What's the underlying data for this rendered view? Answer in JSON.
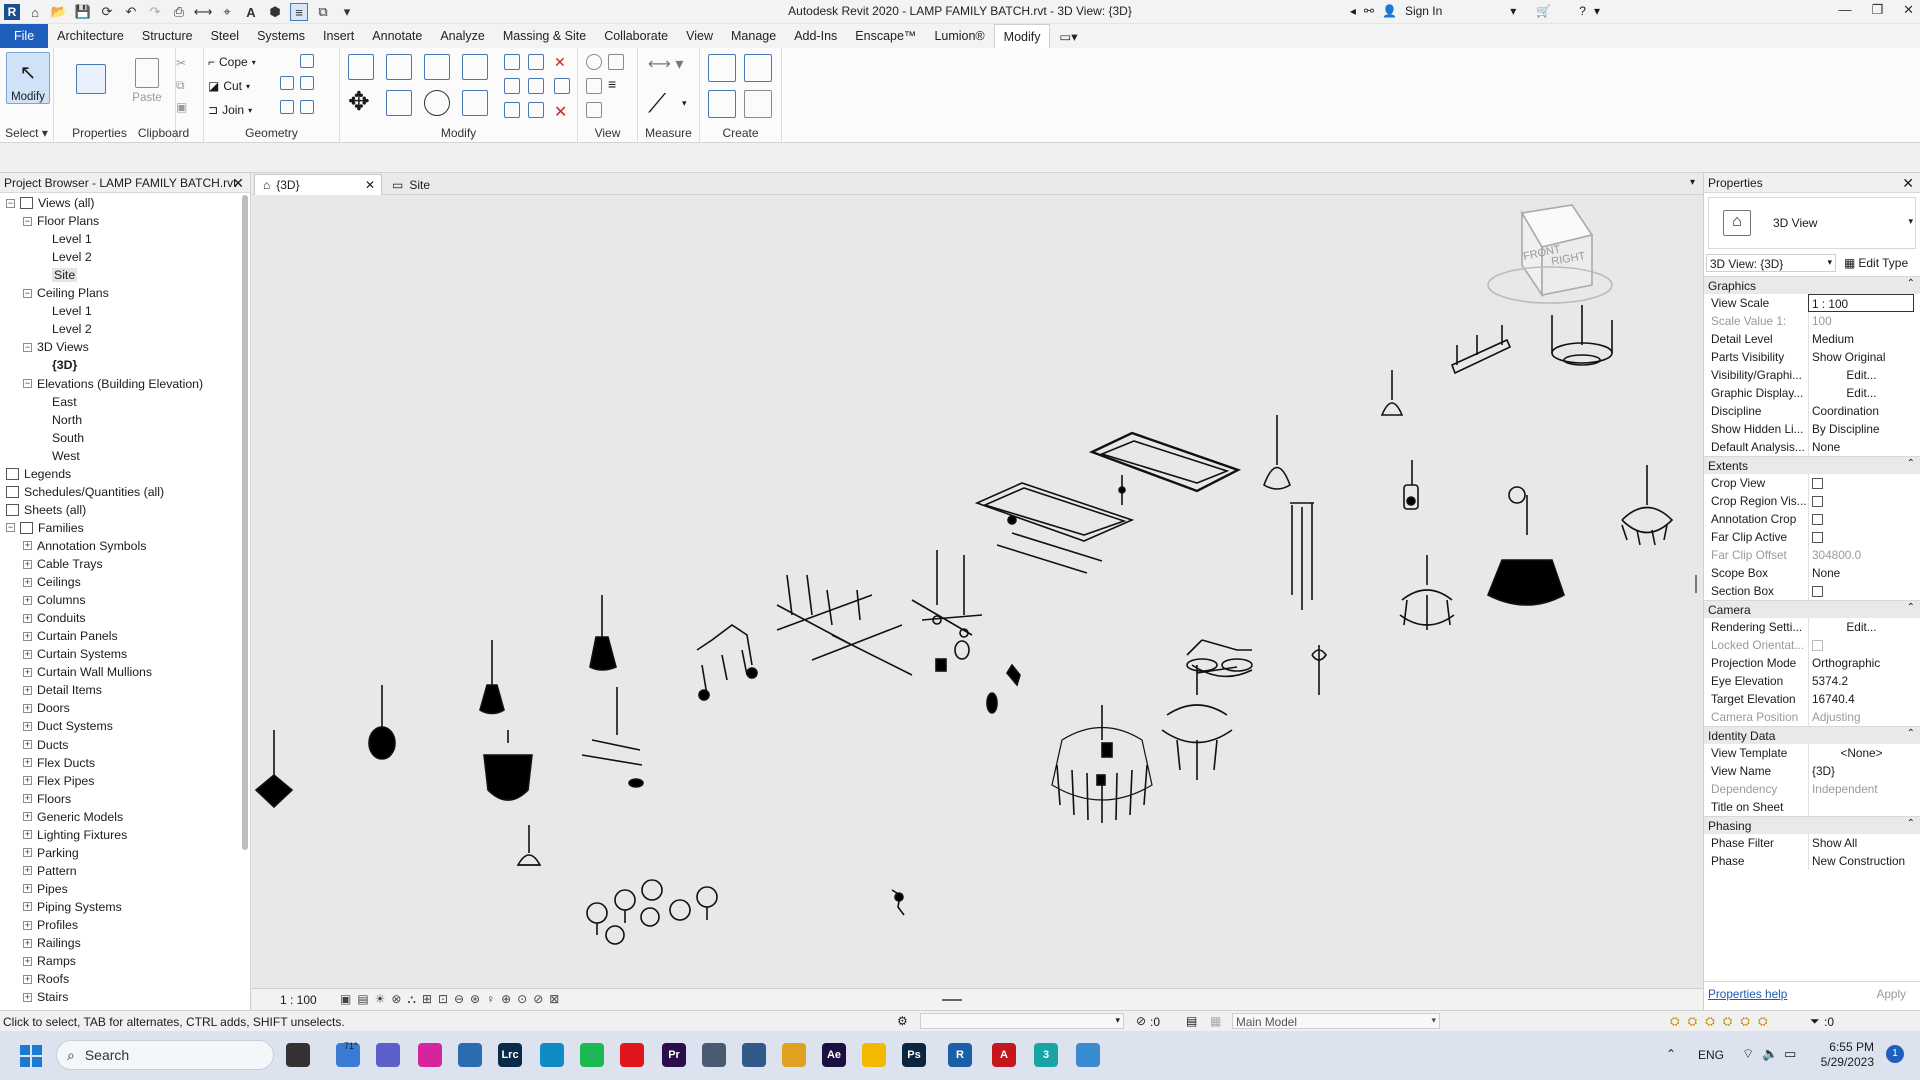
{
  "window": {
    "title": "Autodesk Revit 2020 - LAMP FAMILY BATCH.rvt - 3D View: {3D}",
    "sign_in": "Sign In",
    "logo_letter": "R"
  },
  "menu": {
    "tabs": [
      "File",
      "Architecture",
      "Structure",
      "Steel",
      "Systems",
      "Insert",
      "Annotate",
      "Analyze",
      "Massing & Site",
      "Collaborate",
      "View",
      "Manage",
      "Add-Ins",
      "Enscape™",
      "Lumion®",
      "Modify"
    ],
    "active": "Modify"
  },
  "ribbon": {
    "select": {
      "modify_label": "Modify",
      "panel_label": "Select ▾"
    },
    "properties": {
      "label": "Properties",
      "panel_label": "Properties"
    },
    "clipboard": {
      "paste_label": "Paste",
      "panel_label": "Clipboard"
    },
    "geometry": {
      "cope_label": "Cope",
      "cut_label": "Cut",
      "join_label": "Join",
      "panel_label": "Geometry"
    },
    "modify_panel": {
      "panel_label": "Modify"
    },
    "view_panel": {
      "panel_label": "View"
    },
    "measure_panel": {
      "panel_label": "Measure"
    },
    "create_panel": {
      "panel_label": "Create"
    }
  },
  "browser": {
    "title": "Project Browser - LAMP FAMILY BATCH.rvt",
    "nodes": [
      {
        "label": "Views (all)",
        "level": 0,
        "exp": "−",
        "icon": true
      },
      {
        "label": "Floor Plans",
        "level": 1,
        "exp": "−"
      },
      {
        "label": "Level 1",
        "level": 2
      },
      {
        "label": "Level 2",
        "level": 2
      },
      {
        "label": "Site",
        "level": 2,
        "selected": true
      },
      {
        "label": "Ceiling Plans",
        "level": 1,
        "exp": "−"
      },
      {
        "label": "Level 1",
        "level": 2
      },
      {
        "label": "Level 2",
        "level": 2
      },
      {
        "label": "3D Views",
        "level": 1,
        "exp": "−"
      },
      {
        "label": "{3D}",
        "level": 2,
        "bold": true
      },
      {
        "label": "Elevations (Building Elevation)",
        "level": 1,
        "exp": "−"
      },
      {
        "label": "East",
        "level": 2
      },
      {
        "label": "North",
        "level": 2
      },
      {
        "label": "South",
        "level": 2
      },
      {
        "label": "West",
        "level": 2
      },
      {
        "label": "Legends",
        "level": 0,
        "icon": true
      },
      {
        "label": "Schedules/Quantities (all)",
        "level": 0,
        "icon": true
      },
      {
        "label": "Sheets (all)",
        "level": 0,
        "icon": true
      },
      {
        "label": "Families",
        "level": 0,
        "exp": "−",
        "icon": true
      },
      {
        "label": "Annotation Symbols",
        "level": 1,
        "exp": "+"
      },
      {
        "label": "Cable Trays",
        "level": 1,
        "exp": "+"
      },
      {
        "label": "Ceilings",
        "level": 1,
        "exp": "+"
      },
      {
        "label": "Columns",
        "level": 1,
        "exp": "+"
      },
      {
        "label": "Conduits",
        "level": 1,
        "exp": "+"
      },
      {
        "label": "Curtain Panels",
        "level": 1,
        "exp": "+"
      },
      {
        "label": "Curtain Systems",
        "level": 1,
        "exp": "+"
      },
      {
        "label": "Curtain Wall Mullions",
        "level": 1,
        "exp": "+"
      },
      {
        "label": "Detail Items",
        "level": 1,
        "exp": "+"
      },
      {
        "label": "Doors",
        "level": 1,
        "exp": "+"
      },
      {
        "label": "Duct Systems",
        "level": 1,
        "exp": "+"
      },
      {
        "label": "Ducts",
        "level": 1,
        "exp": "+"
      },
      {
        "label": "Flex Ducts",
        "level": 1,
        "exp": "+"
      },
      {
        "label": "Flex Pipes",
        "level": 1,
        "exp": "+"
      },
      {
        "label": "Floors",
        "level": 1,
        "exp": "+"
      },
      {
        "label": "Generic Models",
        "level": 1,
        "exp": "+"
      },
      {
        "label": "Lighting Fixtures",
        "level": 1,
        "exp": "+"
      },
      {
        "label": "Parking",
        "level": 1,
        "exp": "+"
      },
      {
        "label": "Pattern",
        "level": 1,
        "exp": "+"
      },
      {
        "label": "Pipes",
        "level": 1,
        "exp": "+"
      },
      {
        "label": "Piping Systems",
        "level": 1,
        "exp": "+"
      },
      {
        "label": "Profiles",
        "level": 1,
        "exp": "+"
      },
      {
        "label": "Railings",
        "level": 1,
        "exp": "+"
      },
      {
        "label": "Ramps",
        "level": 1,
        "exp": "+"
      },
      {
        "label": "Roofs",
        "level": 1,
        "exp": "+"
      },
      {
        "label": "Stairs",
        "level": 1,
        "exp": "+"
      }
    ]
  },
  "views": {
    "tabs": [
      {
        "label": "{3D}",
        "active": true
      },
      {
        "label": "Site",
        "active": false
      }
    ],
    "scale": "1 : 100",
    "viewcube_front": "FRONT",
    "viewcube_right": "RIGHT"
  },
  "properties": {
    "title": "Properties",
    "type_name": "3D View",
    "selector": "3D View: {3D}",
    "edit_type": "Edit Type",
    "sections": [
      {
        "name": "Graphics",
        "rows": [
          {
            "k": "View Scale",
            "v": "1 : 100",
            "boxed": true
          },
          {
            "k": "Scale Value    1:",
            "v": "100",
            "gray": true
          },
          {
            "k": "Detail Level",
            "v": "Medium"
          },
          {
            "k": "Parts Visibility",
            "v": "Show Original"
          },
          {
            "k": "Visibility/Graphi...",
            "v": "Edit...",
            "btn": true
          },
          {
            "k": "Graphic Display...",
            "v": "Edit...",
            "btn": true
          },
          {
            "k": "Discipline",
            "v": "Coordination"
          },
          {
            "k": "Show Hidden Li...",
            "v": "By Discipline"
          },
          {
            "k": "Default Analysis...",
            "v": "None"
          }
        ]
      },
      {
        "name": "Extents",
        "rows": [
          {
            "k": "Crop View",
            "chk": true
          },
          {
            "k": "Crop Region Vis...",
            "chk": true
          },
          {
            "k": "Annotation Crop",
            "chk": true
          },
          {
            "k": "Far Clip Active",
            "chk": true
          },
          {
            "k": "Far Clip Offset",
            "v": "304800.0",
            "gray": true
          },
          {
            "k": "Scope Box",
            "v": "None"
          },
          {
            "k": "Section Box",
            "chk": true
          }
        ]
      },
      {
        "name": "Camera",
        "rows": [
          {
            "k": "Rendering Setti...",
            "v": "Edit...",
            "btn": true
          },
          {
            "k": "Locked Orientat...",
            "chk": true,
            "gray": true
          },
          {
            "k": "Projection Mode",
            "v": "Orthographic"
          },
          {
            "k": "Eye Elevation",
            "v": "5374.2"
          },
          {
            "k": "Target Elevation",
            "v": "16740.4"
          },
          {
            "k": "Camera Position",
            "v": "Adjusting",
            "gray": true
          }
        ]
      },
      {
        "name": "Identity Data",
        "rows": [
          {
            "k": "View Template",
            "v": "<None>",
            "btn": true
          },
          {
            "k": "View Name",
            "v": "{3D}"
          },
          {
            "k": "Dependency",
            "v": "Independent",
            "gray": true
          },
          {
            "k": "Title on Sheet",
            "v": ""
          }
        ]
      },
      {
        "name": "Phasing",
        "rows": [
          {
            "k": "Phase Filter",
            "v": "Show All"
          },
          {
            "k": "Phase",
            "v": "New Construction"
          }
        ]
      }
    ],
    "help_link": "Properties help",
    "apply": "Apply"
  },
  "status": {
    "message": "Click to select, TAB for alternates, CTRL adds, SHIFT unselects.",
    "selection_count": ":0",
    "model": "Main Model",
    "filter_count": ":0"
  },
  "taskbar": {
    "search_placeholder": "Search",
    "weather": "71°",
    "lang": "ENG",
    "time": "6:55 PM",
    "date": "5/29/2023",
    "notif": "1",
    "apps": [
      {
        "name": "task-view",
        "color": "#333333",
        "text": ""
      },
      {
        "name": "weather",
        "color": "#3a7bd5",
        "text": ""
      },
      {
        "name": "teams",
        "color": "#5b5fc7",
        "text": ""
      },
      {
        "name": "instagram",
        "color": "#d6249f",
        "text": ""
      },
      {
        "name": "photos",
        "color": "#2b6cb0",
        "text": ""
      },
      {
        "name": "lightroom-classic",
        "color": "#0b2a48",
        "text": "Lrc"
      },
      {
        "name": "edge",
        "color": "#0f8bc6",
        "text": ""
      },
      {
        "name": "spotify",
        "color": "#1db954",
        "text": ""
      },
      {
        "name": "opera",
        "color": "#e0161e",
        "text": ""
      },
      {
        "name": "premiere",
        "color": "#2a0d4a",
        "text": "Pr"
      },
      {
        "name": "app-generic-1",
        "color": "#4a5a70",
        "text": ""
      },
      {
        "name": "app-generic-2",
        "color": "#305a8a",
        "text": ""
      },
      {
        "name": "media",
        "color": "#e0a020",
        "text": ""
      },
      {
        "name": "after-effects",
        "color": "#1a0f3e",
        "text": "Ae"
      },
      {
        "name": "file-explorer",
        "color": "#f2b900",
        "text": ""
      },
      {
        "name": "photoshop",
        "color": "#0b2540",
        "text": "Ps"
      },
      {
        "name": "revit",
        "color": "#1a5fa8",
        "text": "R"
      },
      {
        "name": "autocad",
        "color": "#c4161c",
        "text": "A"
      },
      {
        "name": "3ds-max",
        "color": "#1aa4a4",
        "text": "3"
      },
      {
        "name": "app-generic-3",
        "color": "#3a8ad0",
        "text": ""
      }
    ]
  }
}
